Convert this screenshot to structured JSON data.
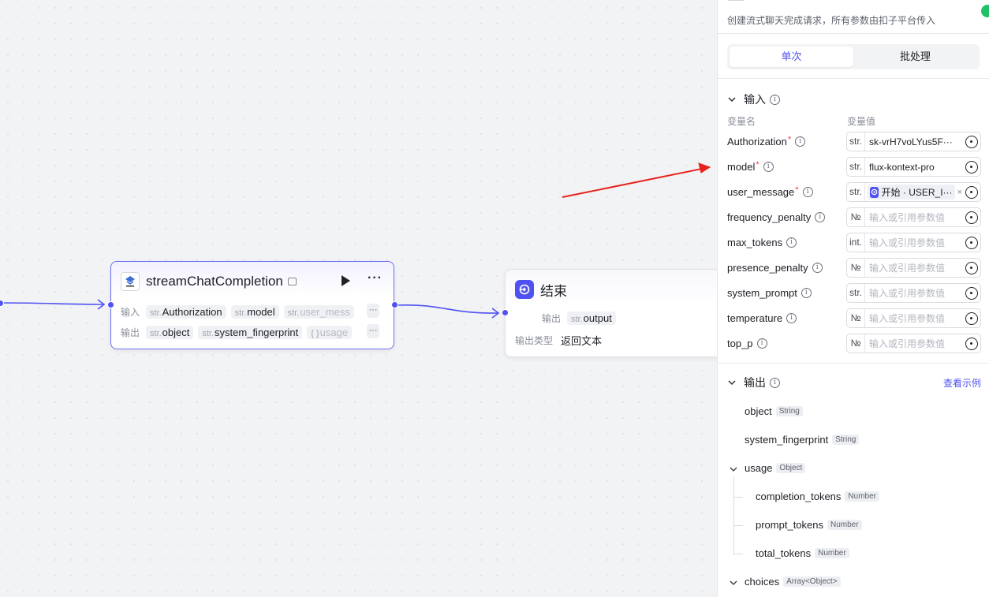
{
  "canvas": {
    "plugin_node": {
      "title": "streamChatCompletion",
      "inputs_label": "输入",
      "outputs_label": "输出",
      "inputs": [
        {
          "type": "str.",
          "name": "Authorization"
        },
        {
          "type": "str.",
          "name": "model"
        },
        {
          "type": "str.",
          "name": "user_mess"
        }
      ],
      "outputs": [
        {
          "type": "str.",
          "name": "object"
        },
        {
          "type": "str.",
          "name": "system_fingerprint"
        },
        {
          "type": "{ }",
          "name": "usage"
        }
      ],
      "more": "···"
    },
    "end_node": {
      "title": "结束",
      "output_label": "输出",
      "output_type": "str.",
      "output_name": "output",
      "output_kind_label": "输出类型",
      "output_kind_value": "返回文本"
    }
  },
  "panel": {
    "description": "创建流式聊天完成请求，所有参数由扣子平台传入",
    "tabs": [
      {
        "label": "单次",
        "active": true
      },
      {
        "label": "批处理",
        "active": false
      }
    ],
    "input_section": {
      "title": "输入",
      "col_name": "变量名",
      "col_value": "变量值",
      "params": [
        {
          "name": "Authorization",
          "required": true,
          "type": "str.",
          "value": "sk-vrH7voLYus5F···",
          "placeholder": ""
        },
        {
          "name": "model",
          "required": true,
          "type": "str.",
          "value": "flux-kontext-pro",
          "placeholder": ""
        },
        {
          "name": "user_message",
          "required": true,
          "type": "str.",
          "value": "",
          "ref": "开始 · USER_I···",
          "placeholder": ""
        },
        {
          "name": "frequency_penalty",
          "required": false,
          "type": "№",
          "value": "",
          "placeholder": "输入或引用参数值"
        },
        {
          "name": "max_tokens",
          "required": false,
          "type": "int.",
          "value": "",
          "placeholder": "输入或引用参数值"
        },
        {
          "name": "presence_penalty",
          "required": false,
          "type": "№",
          "value": "",
          "placeholder": "输入或引用参数值"
        },
        {
          "name": "system_prompt",
          "required": false,
          "type": "str.",
          "value": "",
          "placeholder": "输入或引用参数值"
        },
        {
          "name": "temperature",
          "required": false,
          "type": "№",
          "value": "",
          "placeholder": "输入或引用参数值"
        },
        {
          "name": "top_p",
          "required": false,
          "type": "№",
          "value": "",
          "placeholder": "输入或引用参数值"
        }
      ]
    },
    "output_section": {
      "title": "输出",
      "link": "查看示例",
      "items": [
        {
          "name": "object",
          "type": "String"
        },
        {
          "name": "system_fingerprint",
          "type": "String"
        },
        {
          "name": "usage",
          "type": "Object"
        },
        {
          "name": "completion_tokens",
          "type": "Number"
        },
        {
          "name": "prompt_tokens",
          "type": "Number"
        },
        {
          "name": "total_tokens",
          "type": "Number"
        },
        {
          "name": "choices",
          "type": "Array<Object>"
        }
      ]
    },
    "colors": {
      "accent": "#4f52f0",
      "required": "#e34040",
      "annotation_arrow": "#e8231d"
    }
  }
}
